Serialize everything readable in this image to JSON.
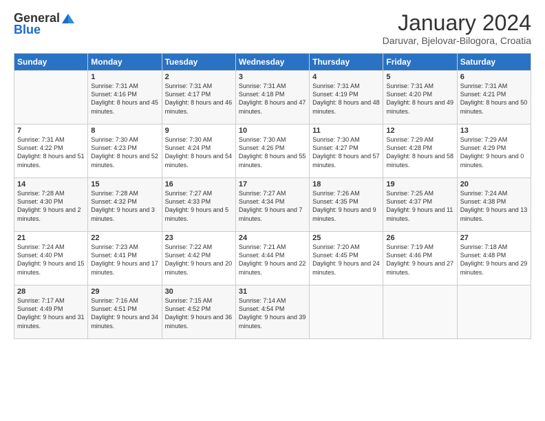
{
  "header": {
    "logo_general": "General",
    "logo_blue": "Blue",
    "month_title": "January 2024",
    "location": "Daruvar, Bjelovar-Bilogora, Croatia"
  },
  "weekdays": [
    "Sunday",
    "Monday",
    "Tuesday",
    "Wednesday",
    "Thursday",
    "Friday",
    "Saturday"
  ],
  "weeks": [
    [
      {
        "day": "",
        "sunrise": "",
        "sunset": "",
        "daylight": ""
      },
      {
        "day": "1",
        "sunrise": "Sunrise: 7:31 AM",
        "sunset": "Sunset: 4:16 PM",
        "daylight": "Daylight: 8 hours and 45 minutes."
      },
      {
        "day": "2",
        "sunrise": "Sunrise: 7:31 AM",
        "sunset": "Sunset: 4:17 PM",
        "daylight": "Daylight: 8 hours and 46 minutes."
      },
      {
        "day": "3",
        "sunrise": "Sunrise: 7:31 AM",
        "sunset": "Sunset: 4:18 PM",
        "daylight": "Daylight: 8 hours and 47 minutes."
      },
      {
        "day": "4",
        "sunrise": "Sunrise: 7:31 AM",
        "sunset": "Sunset: 4:19 PM",
        "daylight": "Daylight: 8 hours and 48 minutes."
      },
      {
        "day": "5",
        "sunrise": "Sunrise: 7:31 AM",
        "sunset": "Sunset: 4:20 PM",
        "daylight": "Daylight: 8 hours and 49 minutes."
      },
      {
        "day": "6",
        "sunrise": "Sunrise: 7:31 AM",
        "sunset": "Sunset: 4:21 PM",
        "daylight": "Daylight: 8 hours and 50 minutes."
      }
    ],
    [
      {
        "day": "7",
        "sunrise": "Sunrise: 7:31 AM",
        "sunset": "Sunset: 4:22 PM",
        "daylight": "Daylight: 8 hours and 51 minutes."
      },
      {
        "day": "8",
        "sunrise": "Sunrise: 7:30 AM",
        "sunset": "Sunset: 4:23 PM",
        "daylight": "Daylight: 8 hours and 52 minutes."
      },
      {
        "day": "9",
        "sunrise": "Sunrise: 7:30 AM",
        "sunset": "Sunset: 4:24 PM",
        "daylight": "Daylight: 8 hours and 54 minutes."
      },
      {
        "day": "10",
        "sunrise": "Sunrise: 7:30 AM",
        "sunset": "Sunset: 4:26 PM",
        "daylight": "Daylight: 8 hours and 55 minutes."
      },
      {
        "day": "11",
        "sunrise": "Sunrise: 7:30 AM",
        "sunset": "Sunset: 4:27 PM",
        "daylight": "Daylight: 8 hours and 57 minutes."
      },
      {
        "day": "12",
        "sunrise": "Sunrise: 7:29 AM",
        "sunset": "Sunset: 4:28 PM",
        "daylight": "Daylight: 8 hours and 58 minutes."
      },
      {
        "day": "13",
        "sunrise": "Sunrise: 7:29 AM",
        "sunset": "Sunset: 4:29 PM",
        "daylight": "Daylight: 9 hours and 0 minutes."
      }
    ],
    [
      {
        "day": "14",
        "sunrise": "Sunrise: 7:28 AM",
        "sunset": "Sunset: 4:30 PM",
        "daylight": "Daylight: 9 hours and 2 minutes."
      },
      {
        "day": "15",
        "sunrise": "Sunrise: 7:28 AM",
        "sunset": "Sunset: 4:32 PM",
        "daylight": "Daylight: 9 hours and 3 minutes."
      },
      {
        "day": "16",
        "sunrise": "Sunrise: 7:27 AM",
        "sunset": "Sunset: 4:33 PM",
        "daylight": "Daylight: 9 hours and 5 minutes."
      },
      {
        "day": "17",
        "sunrise": "Sunrise: 7:27 AM",
        "sunset": "Sunset: 4:34 PM",
        "daylight": "Daylight: 9 hours and 7 minutes."
      },
      {
        "day": "18",
        "sunrise": "Sunrise: 7:26 AM",
        "sunset": "Sunset: 4:35 PM",
        "daylight": "Daylight: 9 hours and 9 minutes."
      },
      {
        "day": "19",
        "sunrise": "Sunrise: 7:25 AM",
        "sunset": "Sunset: 4:37 PM",
        "daylight": "Daylight: 9 hours and 11 minutes."
      },
      {
        "day": "20",
        "sunrise": "Sunrise: 7:24 AM",
        "sunset": "Sunset: 4:38 PM",
        "daylight": "Daylight: 9 hours and 13 minutes."
      }
    ],
    [
      {
        "day": "21",
        "sunrise": "Sunrise: 7:24 AM",
        "sunset": "Sunset: 4:40 PM",
        "daylight": "Daylight: 9 hours and 15 minutes."
      },
      {
        "day": "22",
        "sunrise": "Sunrise: 7:23 AM",
        "sunset": "Sunset: 4:41 PM",
        "daylight": "Daylight: 9 hours and 17 minutes."
      },
      {
        "day": "23",
        "sunrise": "Sunrise: 7:22 AM",
        "sunset": "Sunset: 4:42 PM",
        "daylight": "Daylight: 9 hours and 20 minutes."
      },
      {
        "day": "24",
        "sunrise": "Sunrise: 7:21 AM",
        "sunset": "Sunset: 4:44 PM",
        "daylight": "Daylight: 9 hours and 22 minutes."
      },
      {
        "day": "25",
        "sunrise": "Sunrise: 7:20 AM",
        "sunset": "Sunset: 4:45 PM",
        "daylight": "Daylight: 9 hours and 24 minutes."
      },
      {
        "day": "26",
        "sunrise": "Sunrise: 7:19 AM",
        "sunset": "Sunset: 4:46 PM",
        "daylight": "Daylight: 9 hours and 27 minutes."
      },
      {
        "day": "27",
        "sunrise": "Sunrise: 7:18 AM",
        "sunset": "Sunset: 4:48 PM",
        "daylight": "Daylight: 9 hours and 29 minutes."
      }
    ],
    [
      {
        "day": "28",
        "sunrise": "Sunrise: 7:17 AM",
        "sunset": "Sunset: 4:49 PM",
        "daylight": "Daylight: 9 hours and 31 minutes."
      },
      {
        "day": "29",
        "sunrise": "Sunrise: 7:16 AM",
        "sunset": "Sunset: 4:51 PM",
        "daylight": "Daylight: 9 hours and 34 minutes."
      },
      {
        "day": "30",
        "sunrise": "Sunrise: 7:15 AM",
        "sunset": "Sunset: 4:52 PM",
        "daylight": "Daylight: 9 hours and 36 minutes."
      },
      {
        "day": "31",
        "sunrise": "Sunrise: 7:14 AM",
        "sunset": "Sunset: 4:54 PM",
        "daylight": "Daylight: 9 hours and 39 minutes."
      },
      {
        "day": "",
        "sunrise": "",
        "sunset": "",
        "daylight": ""
      },
      {
        "day": "",
        "sunrise": "",
        "sunset": "",
        "daylight": ""
      },
      {
        "day": "",
        "sunrise": "",
        "sunset": "",
        "daylight": ""
      }
    ]
  ]
}
